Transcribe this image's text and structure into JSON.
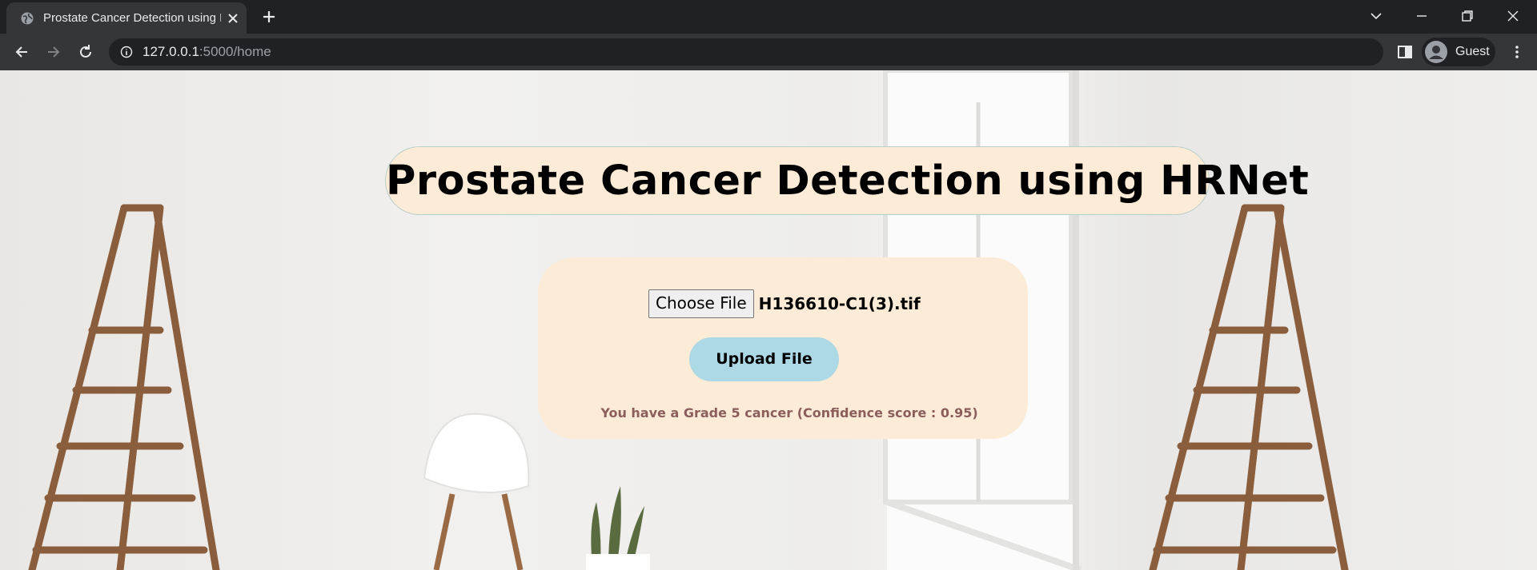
{
  "browser": {
    "tab": {
      "title": "Prostate Cancer Detection using HRNet",
      "favicon": "globe-icon"
    },
    "address": {
      "host": "127.0.0.1",
      "path": ":5000/home"
    },
    "profile": {
      "label": "Guest"
    }
  },
  "page": {
    "title": "Prostate Cancer Detection using HRNet",
    "file_input": {
      "button_label": "Choose File",
      "file_name": "H136610-C1(3).tif"
    },
    "upload_button": "Upload File",
    "result": "You have a Grade 5 cancer (Confidence score : 0.95)",
    "colors": {
      "panel": "#fbebd7",
      "upload_button": "#add8e6",
      "result_text": "#8b5e5b"
    }
  }
}
